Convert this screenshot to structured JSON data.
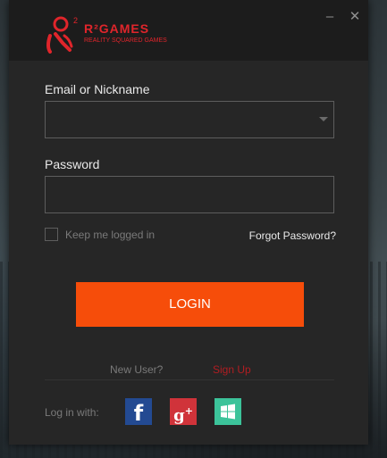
{
  "window": {
    "minimize_label": "–",
    "close_label": "✕"
  },
  "brand": {
    "name": "R²GAMES",
    "tagline": "REALITY SQUARED GAMES",
    "color": "#e0252b",
    "icon": "r2games-logo-icon"
  },
  "form": {
    "email_label": "Email or Nickname",
    "email_value": "",
    "email_placeholder": "",
    "password_label": "Password",
    "password_value": "",
    "password_placeholder": "",
    "keep_logged_in_label": "Keep me logged in",
    "keep_logged_in_checked": false,
    "forgot_password_label": "Forgot Password?",
    "login_label": "LOGIN"
  },
  "signup": {
    "prompt": "New User?",
    "link": "Sign Up"
  },
  "social": {
    "label": "Log in with:",
    "providers": [
      {
        "name": "facebook",
        "glyph": "f",
        "color": "#234a92"
      },
      {
        "name": "google-plus",
        "glyph": "g",
        "superscript": "+",
        "color": "#d0333a"
      },
      {
        "name": "windows",
        "glyph": "",
        "color": "#3cc39a"
      }
    ]
  },
  "colors": {
    "accent": "#f64d0a",
    "window_bg": "#262626",
    "titlebar_bg": "#1c1c1c",
    "signup_link": "#b01d22"
  }
}
